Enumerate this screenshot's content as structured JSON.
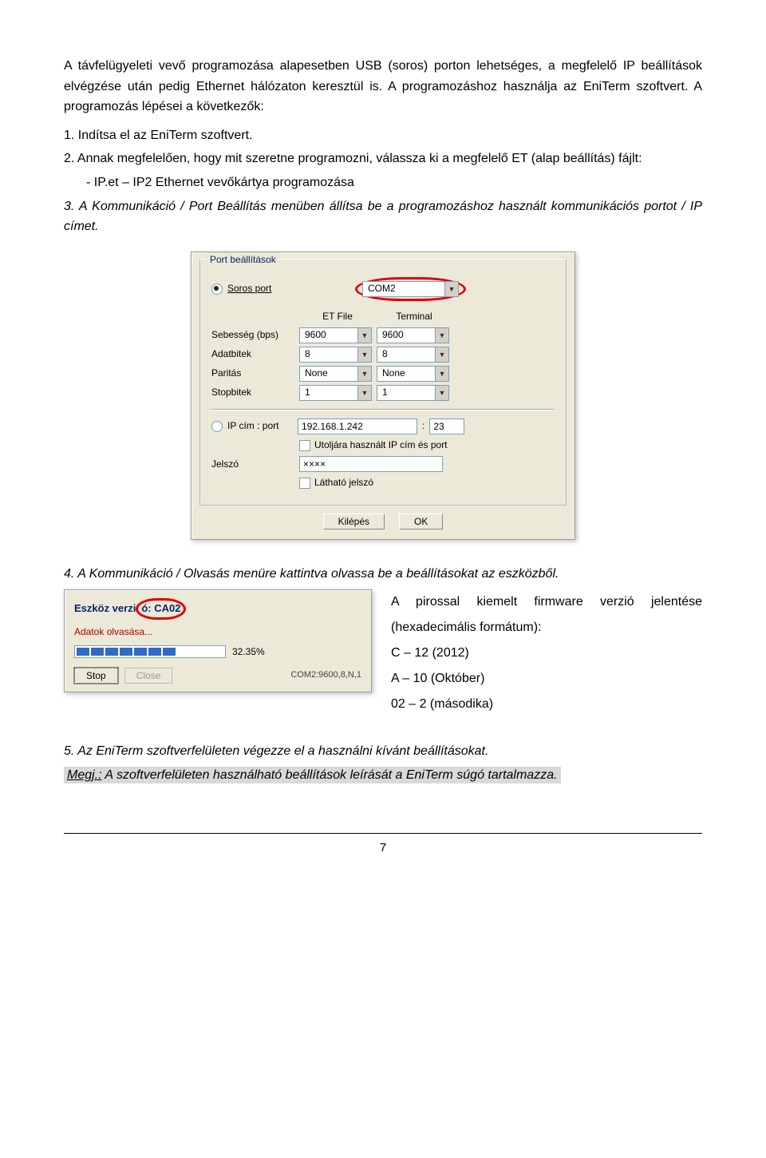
{
  "para_intro": "A távfelügyeleti vevő programozása alapesetben USB (soros) porton lehetséges, a megfelelő IP beállítások elvégzése után pedig Ethernet hálózaton keresztül is. A programozáshoz használja az EniTerm szoftvert. A programozás lépései a következők:",
  "step1": "1. Indítsa el az EniTerm szoftvert.",
  "step2": "2. Annak megfelelően, hogy mit szeretne programozni, válassza ki a megfelelő ET (alap beállítás) fájlt:",
  "step2_sub": "- IP.et – IP2 Ethernet vevőkártya programozása",
  "step3": "3. A Kommunikáció / Port Beállítás menüben állítsa be a programozáshoz használt kommunikációs portot / IP címet.",
  "step4": "4. A Kommunikáció / Olvasás menüre kattintva olvassa be a beállításokat az eszközből.",
  "step5": "5. Az EniTerm szoftverfelületen végezze el a használni kívánt beállításokat.",
  "note_prefix": "Megj.:",
  "note_text": " A szoftverfelületen használható beállítások leírását a EniTerm súgó tartalmazza.",
  "side_l1": "A pirossal kiemelt firmware verzió jelentése (hexadecimális formátum):",
  "side_l2": "C – 12 (2012)",
  "side_l3": "A – 10 (Október)",
  "side_l4": "02 – 2 (másodika)",
  "dlg1": {
    "group_title": "Port beállítások",
    "radio_serial": "Soros port",
    "com_val": "COM2",
    "col_et": "ET File",
    "col_term": "Terminal",
    "speed_lbl": "Sebesség (bps)",
    "speed_et": "9600",
    "speed_term": "9600",
    "data_lbl": "Adatbitek",
    "data_et": "8",
    "data_term": "8",
    "parity_lbl": "Paritás",
    "parity_et": "None",
    "parity_term": "None",
    "stop_lbl": "Stopbitek",
    "stop_et": "1",
    "stop_term": "1",
    "radio_ip": "IP cím : port",
    "ip_val": "192.168.1.242",
    "ip_port": "23",
    "chk_lastip": "Utoljára használt IP cím és port",
    "pwd_lbl": "Jelszó",
    "pwd_val": "××××",
    "chk_showpwd": "Látható jelszó",
    "btn_exit": "Kilépés",
    "btn_ok": "OK"
  },
  "dlg2": {
    "dev_ver_label": "Eszköz verzió:",
    "dev_ver_val": "CA02",
    "reading": "Adatok olvasása...",
    "percent": "32.35%",
    "btn_stop": "Stop",
    "btn_close": "Close",
    "status": "COM2:9600,8,N,1"
  },
  "page_num": "7"
}
